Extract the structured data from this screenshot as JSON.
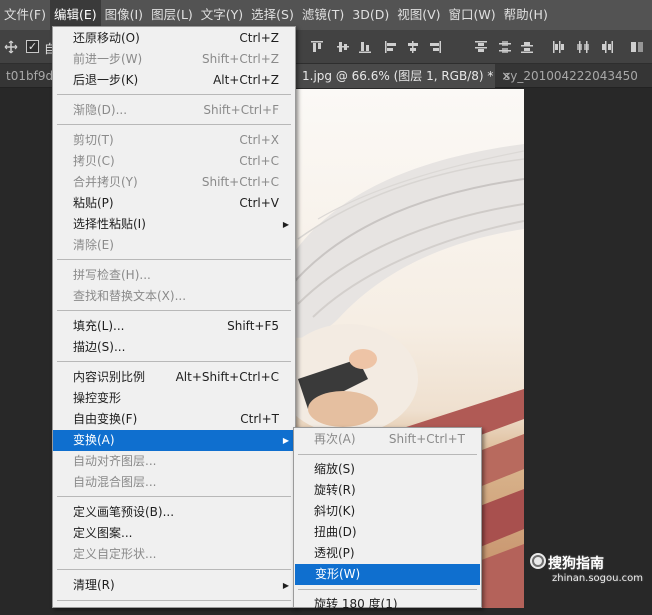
{
  "menubar": {
    "items": [
      {
        "label": "文件(F)",
        "active": false
      },
      {
        "label": "编辑(E)",
        "active": true
      },
      {
        "label": "图像(I)",
        "active": false
      },
      {
        "label": "图层(L)",
        "active": false
      },
      {
        "label": "文字(Y)",
        "active": false
      },
      {
        "label": "选择(S)",
        "active": false
      },
      {
        "label": "滤镜(T)",
        "active": false
      },
      {
        "label": "3D(D)",
        "active": false
      },
      {
        "label": "视图(V)",
        "active": false
      },
      {
        "label": "窗口(W)",
        "active": false
      },
      {
        "label": "帮助(H)",
        "active": false
      }
    ]
  },
  "options_bar": {
    "auto_select_label": "自",
    "auto_select_checked": true
  },
  "tabs": [
    {
      "label": "t01bf9d",
      "active": false,
      "close": ""
    },
    {
      "label": "1.jpg @ 66.6% (图层 1, RGB/8) *",
      "active": true,
      "close": "×"
    },
    {
      "label": "sy_2010042220434­50",
      "active": false,
      "close": ""
    }
  ],
  "edit_menu": {
    "items": [
      {
        "label": "还原移动(O)",
        "shortcut": "Ctrl+Z",
        "disabled": false
      },
      {
        "label": "前进一步(W)",
        "shortcut": "Shift+Ctrl+Z",
        "disabled": true
      },
      {
        "label": "后退一步(K)",
        "shortcut": "Alt+Ctrl+Z",
        "disabled": false
      },
      {
        "label": "渐隐(D)...",
        "shortcut": "Shift+Ctrl+F",
        "disabled": true
      },
      {
        "label": "剪切(T)",
        "shortcut": "Ctrl+X",
        "disabled": true
      },
      {
        "label": "拷贝(C)",
        "shortcut": "Ctrl+C",
        "disabled": true
      },
      {
        "label": "合并拷贝(Y)",
        "shortcut": "Shift+Ctrl+C",
        "disabled": true
      },
      {
        "label": "粘贴(P)",
        "shortcut": "Ctrl+V",
        "disabled": false
      },
      {
        "label": "选择性粘贴(I)",
        "shortcut": "",
        "disabled": false,
        "submenu": true
      },
      {
        "label": "清除(E)",
        "shortcut": "",
        "disabled": true
      },
      {
        "label": "拼写检查(H)...",
        "shortcut": "",
        "disabled": true
      },
      {
        "label": "查找和替换文本(X)...",
        "shortcut": "",
        "disabled": true
      },
      {
        "label": "填充(L)...",
        "shortcut": "Shift+F5",
        "disabled": false
      },
      {
        "label": "描边(S)...",
        "shortcut": "",
        "disabled": false
      },
      {
        "label": "内容识别比例",
        "shortcut": "Alt+Shift+Ctrl+C",
        "disabled": false
      },
      {
        "label": "操控变形",
        "shortcut": "",
        "disabled": false
      },
      {
        "label": "自由变换(F)",
        "shortcut": "Ctrl+T",
        "disabled": false
      },
      {
        "label": "变换(A)",
        "shortcut": "",
        "disabled": false,
        "submenu": true,
        "highlight": true
      },
      {
        "label": "自动对齐图层...",
        "shortcut": "",
        "disabled": true
      },
      {
        "label": "自动混合图层...",
        "shortcut": "",
        "disabled": true
      },
      {
        "label": "定义画笔预设(B)...",
        "shortcut": "",
        "disabled": false
      },
      {
        "label": "定义图案...",
        "shortcut": "",
        "disabled": false
      },
      {
        "label": "定义自定形状...",
        "shortcut": "",
        "disabled": true
      },
      {
        "label": "清理(R)",
        "shortcut": "",
        "disabled": false,
        "submenu": true
      }
    ],
    "submenu_arrow": "▶"
  },
  "transform_submenu": {
    "items": [
      {
        "label": "再次(A)",
        "shortcut": "Shift+Ctrl+T",
        "disabled": true
      },
      {
        "label": "缩放(S)",
        "shortcut": "",
        "disabled": false
      },
      {
        "label": "旋转(R)",
        "shortcut": "",
        "disabled": false
      },
      {
        "label": "斜切(K)",
        "shortcut": "",
        "disabled": false
      },
      {
        "label": "扭曲(D)",
        "shortcut": "",
        "disabled": false
      },
      {
        "label": "透视(P)",
        "shortcut": "",
        "disabled": false
      },
      {
        "label": "变形(W)",
        "shortcut": "",
        "disabled": false,
        "highlight": true
      },
      {
        "label": "旋转 180 度(1)",
        "shortcut": "",
        "disabled": false
      }
    ]
  },
  "watermark": {
    "brand": "搜狗指南",
    "url": "zhinan.sogou.com"
  },
  "colors": {
    "menu_highlight": "#0f6fcf",
    "menubar_bg": "#535353",
    "menu_bg": "#f0f0f0"
  }
}
